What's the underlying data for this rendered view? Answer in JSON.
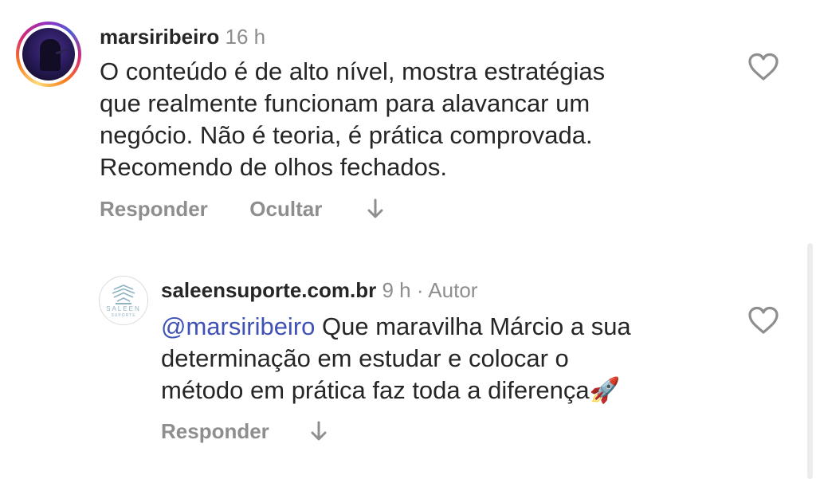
{
  "comments": [
    {
      "username": "marsiribeiro",
      "time": "16 h",
      "text_lines": [
        "O conteúdo é de alto nível, mostra estratégias",
        "que realmente funcionam para alavancar um",
        "negócio. Não é teoria, é prática comprovada.",
        "Recomendo de olhos fechados."
      ],
      "actions": {
        "reply": "Responder",
        "hide": "Ocultar"
      },
      "liked": false
    }
  ],
  "reply": {
    "username": "saleensuporte.com.br",
    "time": "9 h",
    "separator": "·",
    "author_badge": "Autor",
    "mention": "@marsiribeiro",
    "text_lines": [
      " Que maravilha Márcio a sua",
      "determinação em estudar e colocar  o",
      "método em prática  faz toda a diferença🚀"
    ],
    "actions": {
      "reply": "Responder"
    },
    "logo_text": "SALEEN",
    "logo_subtext": "SUPORTE",
    "liked": false
  },
  "colors": {
    "text": "#262626",
    "muted": "#8e8e8e",
    "mention": "#3f51b5"
  }
}
